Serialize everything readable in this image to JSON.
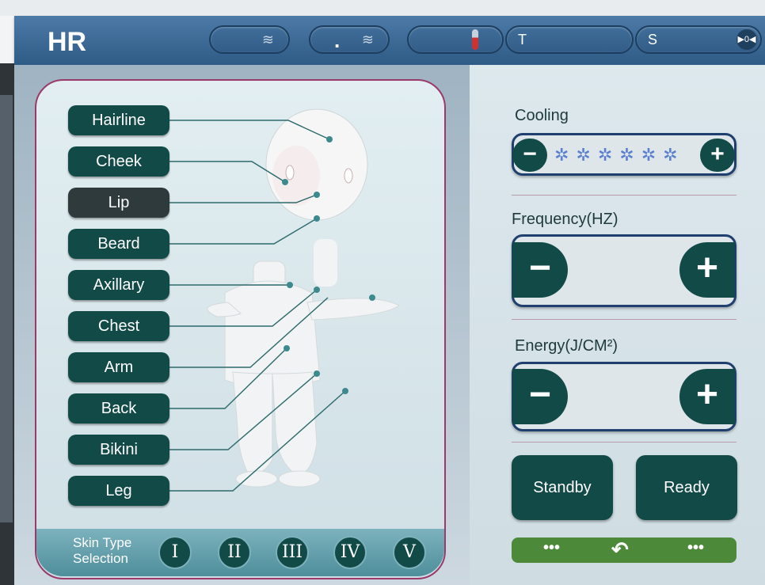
{
  "header": {
    "title": "HR",
    "pills": [
      {
        "name": "wave-pill",
        "icon": "water-wave-icon",
        "text": ""
      },
      {
        "name": "dot-wave-pill",
        "icon": "water-wave-icon",
        "text": "."
      },
      {
        "name": "temperature-pill",
        "icon": "thermometer-icon",
        "text": ""
      },
      {
        "name": "t-pill",
        "text": "T"
      },
      {
        "name": "s-pill",
        "text": "S",
        "icon": "play-counter-icon",
        "icon_text": "▶0◀"
      }
    ]
  },
  "body_parts": [
    "Hairline",
    "Cheek",
    "Lip",
    "Beard",
    "Axillary",
    "Chest",
    "Arm",
    "Back",
    "Bikini",
    "Leg"
  ],
  "skin_type": {
    "label_line1": "Skin Type",
    "label_line2": "Selection",
    "options": [
      "I",
      "II",
      "III",
      "IV",
      "V"
    ]
  },
  "cooling": {
    "title": "Cooling",
    "minus": "−",
    "plus": "+",
    "level_icons": "✲✲✲✲✲✲"
  },
  "frequency": {
    "title": "Frequency(HZ)",
    "minus": "−",
    "plus": "+"
  },
  "energy": {
    "title": "Energy(J/CM²)",
    "minus": "−",
    "plus": "+"
  },
  "buttons": {
    "standby": "Standby",
    "ready": "Ready"
  },
  "nav": {
    "left": "•••",
    "back_icon": "back-arrow-icon",
    "right": "•••"
  },
  "colors": {
    "accent": "#124a48",
    "header": "#3b6a96",
    "nav_bar": "#4c8a3a"
  }
}
